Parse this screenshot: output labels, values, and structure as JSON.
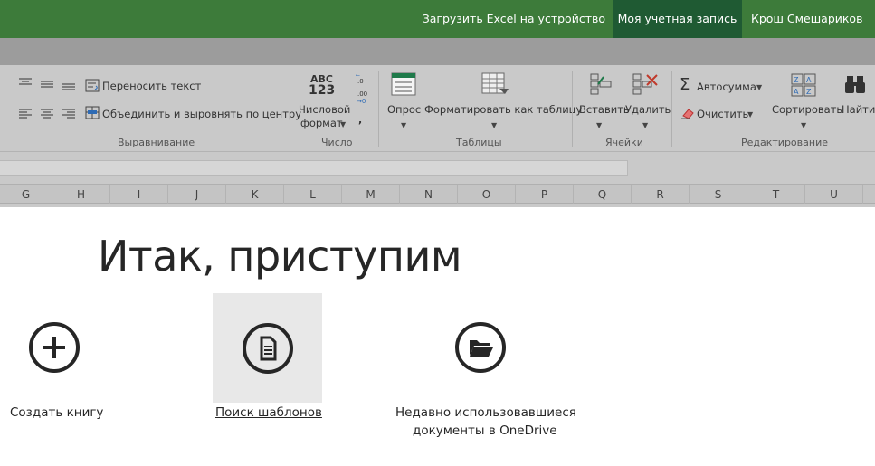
{
  "topbar": {
    "download": "Загрузить Excel на устройство",
    "account": "Моя учетная запись",
    "user": "Крош Смешариков"
  },
  "ribbon": {
    "alignment": {
      "wrap_text": "Переносить текст",
      "merge_center": "Объединить и выровнять по центру",
      "label": "Выравнивание"
    },
    "number": {
      "format_line1": "Числовой",
      "format_line2": "формат",
      "label": "Число",
      "abc": "ABC",
      "num": "123"
    },
    "tables": {
      "survey": "Опрос",
      "format_table": "Форматировать как таблицу",
      "label": "Таблицы"
    },
    "cells": {
      "insert": "Вставить",
      "delete": "Удалить",
      "label": "Ячейки"
    },
    "editing": {
      "autosum": "Автосумма",
      "clear": "Очистить",
      "sort": "Сортировать",
      "find": "Найти",
      "label": "Редактирование"
    }
  },
  "columns": [
    "G",
    "H",
    "I",
    "J",
    "K",
    "L",
    "M",
    "N",
    "O",
    "P",
    "Q",
    "R",
    "S",
    "T",
    "U"
  ],
  "start": {
    "title": "Итак, приступим",
    "new_workbook": "Создать книгу",
    "search_templates": "Поиск шаблонов",
    "recent_line1": "Недавно использовавшиеся",
    "recent_line2": "документы в OneDrive"
  }
}
